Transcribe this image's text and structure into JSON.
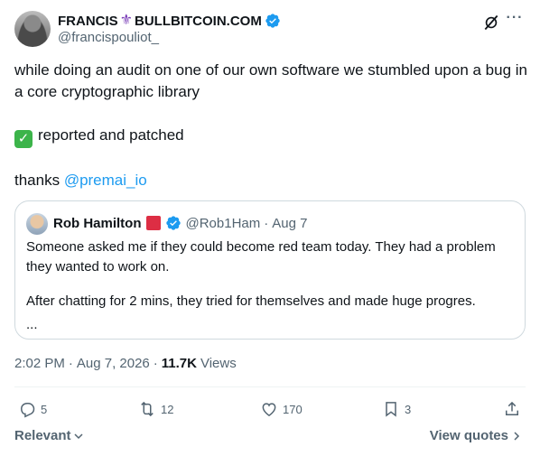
{
  "author": {
    "display_name_part1": "FRANCIS",
    "display_name_part2": "BULLBITCOIN.COM",
    "emoji_icon": "fleur-de-lis-icon",
    "handle": "@francispouliot_",
    "verified": true
  },
  "tweet": {
    "line1": "while doing an audit on one of our own software we stumbled upon a bug in a core cryptographic library",
    "line2": "reported and patched",
    "line3_prefix": "thanks ",
    "mention": "@premai_io"
  },
  "quote": {
    "name": "Rob Hamilton",
    "handle": "@Rob1Ham",
    "dot": "·",
    "date": "Aug 7",
    "para1": "Someone asked me if they could become red team today. They had a problem they wanted to work on.",
    "para2": "After chatting for 2 mins, they tried for themselves and made huge progres.",
    "ellipsis": "..."
  },
  "meta": {
    "time": "2:02 PM",
    "date": "Aug 7, 2026",
    "sep": "·",
    "views_count": "11.7K",
    "views_label": "Views"
  },
  "actions": {
    "replies": "5",
    "reposts": "12",
    "likes": "170",
    "bookmarks": "3"
  },
  "footer": {
    "relevant": "Relevant",
    "view_quotes": "View quotes"
  },
  "colors": {
    "accent": "#1d9bf0",
    "text": "#0f1419",
    "secondary": "#536471",
    "border": "#cfd9de"
  }
}
